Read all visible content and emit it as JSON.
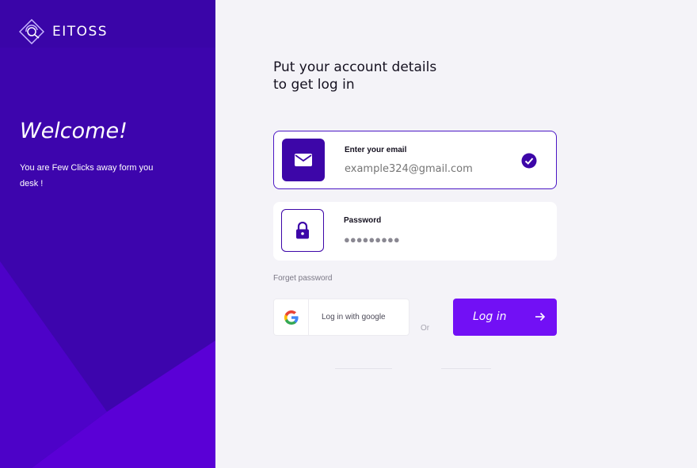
{
  "brand": {
    "name": "EITOSS",
    "logo_icon": "diamond-swirl-logo"
  },
  "left_panel": {
    "welcome": "Welcome!",
    "tagline": "You are Few Clicks away form you desk !"
  },
  "form": {
    "heading_line1": "Put your account details",
    "heading_line2": "to get log in",
    "email": {
      "label": "Enter your email",
      "placeholder": "example324@gmail.com",
      "icon": "envelope-icon",
      "status_icon": "check-circle-icon"
    },
    "password": {
      "label": "Password",
      "value_masked": "●●●●●●●●●",
      "icon": "lock-icon"
    },
    "forgot_label": "Forget password",
    "google_label": "Log in with google",
    "or_label": "Or",
    "login_label": "Log in"
  },
  "colors": {
    "left_panel": "#3a05a8",
    "accent": "#7210f5",
    "icon_fill": "#3d06a8",
    "background": "#f4f3f8"
  }
}
